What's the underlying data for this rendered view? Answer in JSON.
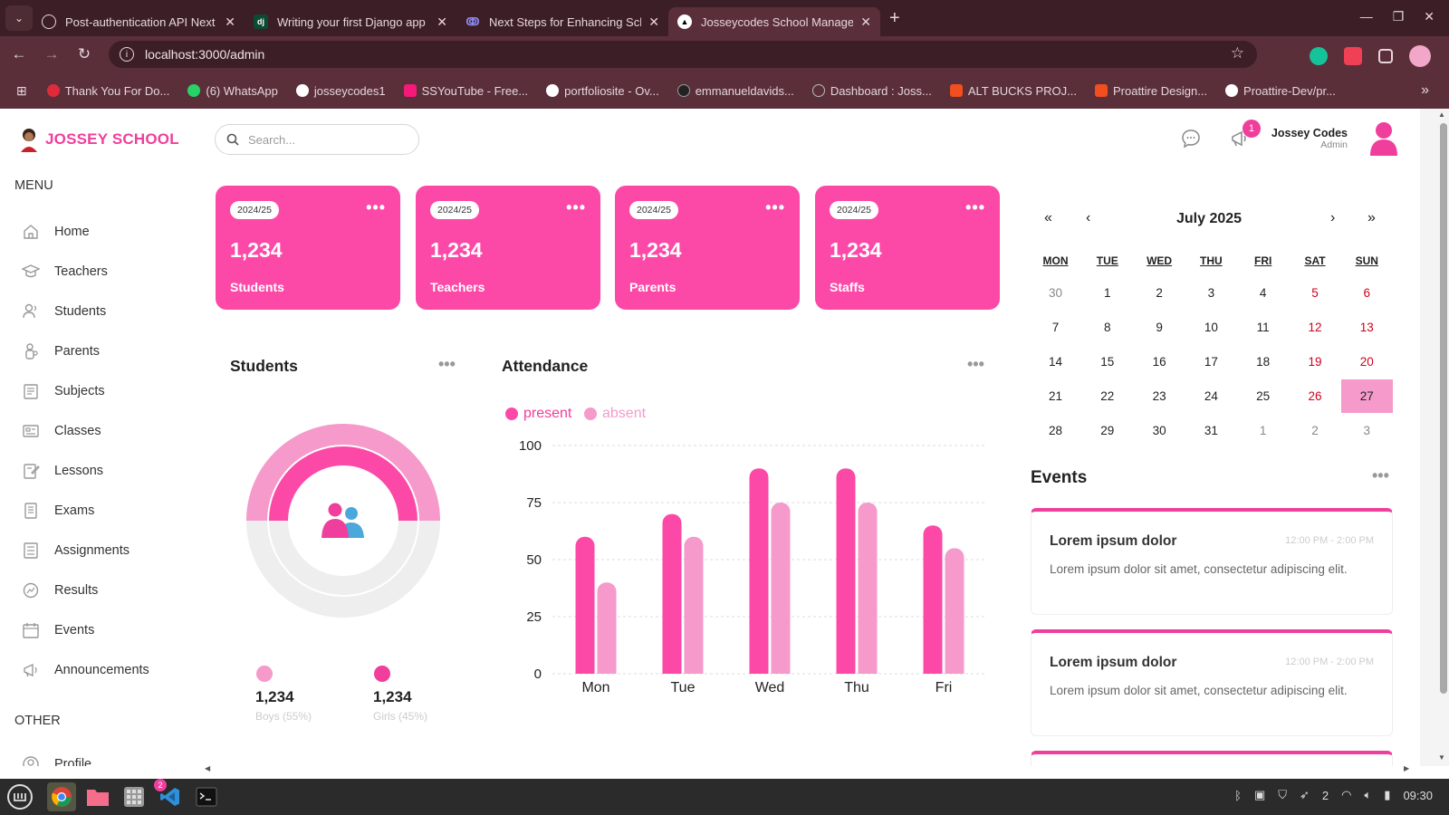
{
  "browser": {
    "tabs": [
      {
        "title": "Post-authentication API Next",
        "icon": "openai-icon"
      },
      {
        "title": "Writing your first Django app",
        "icon": "django-icon"
      },
      {
        "title": "Next Steps for Enhancing Sch",
        "icon": "claude-icon"
      },
      {
        "title": "Josseycodes School Manager",
        "icon": "nextjs-icon",
        "active": true
      }
    ],
    "url": "localhost:3000/admin",
    "bookmarks": [
      {
        "label": "Thank You For Do...",
        "color": "#e02a3a"
      },
      {
        "label": "(6) WhatsApp",
        "color": "#25d366"
      },
      {
        "label": "josseycodes1",
        "color": "#ffffff"
      },
      {
        "label": "SSYouTube - Free...",
        "color": "#f5197a"
      },
      {
        "label": "portfoliosite - Ov...",
        "color": "#ffffff"
      },
      {
        "label": "emmanueldavids...",
        "color": "#222222"
      },
      {
        "label": "Dashboard : Joss...",
        "color": "#888888"
      },
      {
        "label": "ALT BUCKS PROJ...",
        "color": "#f24e1e"
      },
      {
        "label": "Proattire Design...",
        "color": "#f24e1e"
      },
      {
        "label": "Proattire-Dev/pr...",
        "color": "#ffffff"
      }
    ]
  },
  "app": {
    "brand": "JOSSEY SCHOOL",
    "search_placeholder": "Search...",
    "notifications_count": "1",
    "user": {
      "name": "Jossey Codes",
      "role": "Admin"
    },
    "menu_heading": "MENU",
    "other_heading": "OTHER",
    "menu": [
      {
        "label": "Home",
        "icon": "home-icon"
      },
      {
        "label": "Teachers",
        "icon": "teacher-icon"
      },
      {
        "label": "Students",
        "icon": "student-icon"
      },
      {
        "label": "Parents",
        "icon": "parent-icon"
      },
      {
        "label": "Subjects",
        "icon": "subject-icon"
      },
      {
        "label": "Classes",
        "icon": "class-icon"
      },
      {
        "label": "Lessons",
        "icon": "lesson-icon"
      },
      {
        "label": "Exams",
        "icon": "exam-icon"
      },
      {
        "label": "Assignments",
        "icon": "assignment-icon"
      },
      {
        "label": "Results",
        "icon": "result-icon"
      },
      {
        "label": "Events",
        "icon": "calendar-icon"
      },
      {
        "label": "Announcements",
        "icon": "announcement-icon"
      }
    ],
    "other": [
      {
        "label": "Profile",
        "icon": "profile-icon"
      }
    ],
    "cards": [
      {
        "year": "2024/25",
        "count": "1,234",
        "label": "Students"
      },
      {
        "year": "2024/25",
        "count": "1,234",
        "label": "Teachers"
      },
      {
        "year": "2024/25",
        "count": "1,234",
        "label": "Parents"
      },
      {
        "year": "2024/25",
        "count": "1,234",
        "label": "Staffs"
      }
    ],
    "students_chart": {
      "title": "Students",
      "boys": {
        "count": "1,234",
        "label": "Boys (55%)"
      },
      "girls": {
        "count": "1,234",
        "label": "Girls (45%)"
      }
    },
    "attendance": {
      "title": "Attendance",
      "legend_present": "present",
      "legend_absent": "absent"
    },
    "calendar": {
      "month": "July 2025",
      "nav": [
        "«",
        "‹",
        "›",
        "»"
      ],
      "days_of_week": [
        "MON",
        "TUE",
        "WED",
        "THU",
        "FRI",
        "SAT",
        "SUN"
      ],
      "weeks": [
        [
          "30",
          "1",
          "2",
          "3",
          "4",
          "5",
          "6"
        ],
        [
          "7",
          "8",
          "9",
          "10",
          "11",
          "12",
          "13"
        ],
        [
          "14",
          "15",
          "16",
          "17",
          "18",
          "19",
          "20"
        ],
        [
          "21",
          "22",
          "23",
          "24",
          "25",
          "26",
          "27"
        ],
        [
          "28",
          "29",
          "30",
          "31",
          "1",
          "2",
          "3"
        ]
      ],
      "today": "27"
    },
    "events": {
      "title": "Events",
      "items": [
        {
          "title": "Lorem ipsum dolor",
          "time": "12:00 PM - 2:00 PM",
          "description": "Lorem ipsum dolor sit amet, consectetur adipiscing elit."
        },
        {
          "title": "Lorem ipsum dolor",
          "time": "12:00 PM - 2:00 PM",
          "description": "Lorem ipsum dolor sit amet, consectetur adipiscing elit."
        }
      ]
    }
  },
  "chart_data": [
    {
      "type": "pie",
      "title": "Students",
      "categories": [
        "Boys",
        "Girls"
      ],
      "values": [
        55,
        45
      ],
      "colors": [
        "#f59acb",
        "#fc49a8"
      ]
    },
    {
      "type": "bar",
      "title": "Attendance",
      "categories": [
        "Mon",
        "Tue",
        "Wed",
        "Thu",
        "Fri"
      ],
      "series": [
        {
          "name": "present",
          "values": [
            60,
            70,
            90,
            90,
            65
          ],
          "color": "#fc49a8"
        },
        {
          "name": "absent",
          "values": [
            40,
            60,
            75,
            75,
            55
          ],
          "color": "#f59acb"
        }
      ],
      "yticks": [
        "0",
        "25",
        "50",
        "75",
        "100"
      ],
      "ylim": [
        0,
        100
      ],
      "grid": true,
      "legend": "top-left"
    }
  ],
  "taskbar": {
    "vscode_badge": "2",
    "wifi_count": "2",
    "clock": "09:30"
  },
  "colors": {
    "accent": "#fc49a8",
    "accent_light": "#f59acb",
    "chrome": "#5a2f3a"
  }
}
